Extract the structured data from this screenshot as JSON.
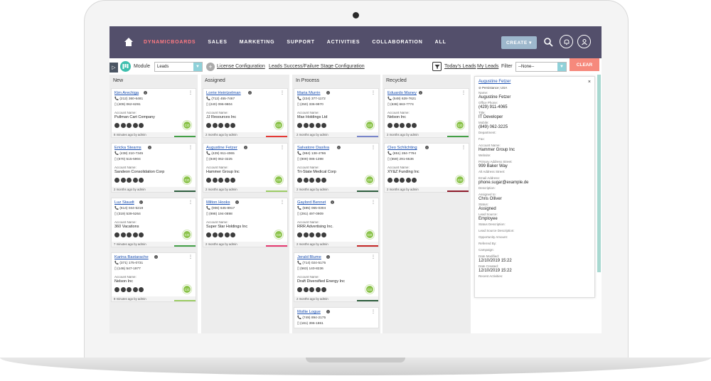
{
  "nav": {
    "items": [
      "DYNAMICBOARDS",
      "SALES",
      "MARKETING",
      "SUPPORT",
      "ACTIVITIES",
      "COLLABORATION",
      "ALL"
    ],
    "create_label": "CREATE ▾"
  },
  "toolbar": {
    "expander": "▷",
    "module_label": "Module",
    "module_value": "Leads",
    "license_link": "License Configuration",
    "stage_link": "Leads Success/Failure Stage Configuration",
    "todays_leads": "Today's Leads",
    "my_leads": "My Leads",
    "filter_label": "Filter",
    "filter_value": "--None--",
    "clear_label": "CLEAR"
  },
  "colors": {
    "nav_bg": "#534f6b",
    "active_nav": "#ff7a82",
    "clear": "#f6897c",
    "avatar": "#8bc34a"
  },
  "columns": [
    {
      "title": "New",
      "cards": [
        {
          "name": "Kim Arechiga",
          "phone1": "(212) 360-6481",
          "phone2": "(409) 062-6291",
          "account_label": "Account Name:",
          "account": "Pullman Cart Company",
          "avatar": "CO",
          "footer": "8 minutes ago by admin",
          "bar": "#43a047"
        },
        {
          "name": "Ericka Stearns",
          "phone1": "(438) 210-7345",
          "phone2": "(670) 515-5904",
          "account_label": "Account Name:",
          "account": "Sandeon Consolidation Corp",
          "avatar": "CO",
          "footer": "2 months ago by admin",
          "bar": "#2e5e3e"
        },
        {
          "name": "Luz Staudt",
          "phone1": "(614) 044-5218",
          "phone2": "(319) 539-5264",
          "account_label": "Account Name:",
          "account": "360 Vacations",
          "avatar": "CO",
          "footer": "7 minutes ago by admin",
          "bar": "#43a047"
        },
        {
          "name": "Karina Bastarache",
          "phone1": "(371) 175-0731",
          "phone2": "(146) 547-1977",
          "account_label": "Account Name:",
          "account": "Nelson Inc",
          "avatar": "CO",
          "footer": "8 minutes ago by admin",
          "bar": "#9ccc65"
        }
      ]
    },
    {
      "title": "Assigned",
      "cards": [
        {
          "name": "Lorrie Heintzelman",
          "phone1": "(712) 455-7467",
          "phone2": "(240) 096-9804",
          "account_label": "Account Name:",
          "account": "JJ Resources Inc",
          "avatar": "CO",
          "footer": "2 months ago by admin",
          "bar": "#e53935"
        },
        {
          "name": "Augustine Fetzer",
          "phone1": "(429) 911-4065",
          "phone2": "(849) 062-3225",
          "account_label": "Account Name:",
          "account": "Hammer Group Inc",
          "avatar": "CO",
          "footer": "2 months ago by admin",
          "bar": "#9ccc65"
        },
        {
          "name": "Milton Hooks",
          "phone1": "(006) 645-8917",
          "phone2": "(998) 194-0898",
          "account_label": "Account Name:",
          "account": "Super Star Holdings Inc",
          "avatar": "CO",
          "footer": "2 months ago by admin",
          "bar": "#e53970"
        }
      ]
    },
    {
      "title": "In Process",
      "cards": [
        {
          "name": "Maria Murrin",
          "phone1": "(224) 377-1172",
          "phone2": "(250) 336-9970",
          "account_label": "Account Name:",
          "account": "Max Holdings Ltd",
          "avatar": "CO",
          "footer": "2 months ago by admin",
          "bar": "#7986cb"
        },
        {
          "name": "Salvatore Dasilva",
          "phone1": "(984) 138-4786",
          "phone2": "(809) 086-1398",
          "account_label": "Account Name:",
          "account": "Tri-State Medical Corp",
          "avatar": "CO",
          "footer": "2 months ago by admin",
          "bar": "#2e5e3e"
        },
        {
          "name": "Gaylord Bennet",
          "phone1": "(595) 065-0304",
          "phone2": "(291) 497-0909",
          "account_label": "Account Name:",
          "account": "RRR Advertising Inc.",
          "avatar": "CO",
          "footer": "2 months ago by admin",
          "bar": "#c62828"
        },
        {
          "name": "Jerald Blume",
          "phone1": "(714) 024-5175",
          "phone2": "(563) 140-8236",
          "account_label": "Account Name:",
          "account": "Draft Diversified Energy Inc",
          "avatar": "CO",
          "footer": "2 months ago by admin",
          "bar": "#2e5e3e"
        },
        {
          "name": "Mollie Logue",
          "phone1": "(749) 894-2175",
          "phone2": "(181) 396-1861",
          "account_label": "",
          "account": "",
          "avatar": "",
          "footer": "",
          "bar": ""
        }
      ]
    },
    {
      "title": "Recycled",
      "cards": [
        {
          "name": "Eduardo Maney",
          "phone1": "(548) 628-7621",
          "phone2": "(638) 663-7774",
          "account_label": "Account Name:",
          "account": "Nelson Inc",
          "avatar": "CO",
          "footer": "2 months ago by admin",
          "bar": "#43a047"
        },
        {
          "name": "Cleo Schlichting",
          "phone1": "(851) 284-7794",
          "phone2": "(559) 291-6536",
          "account_label": "Account Name:",
          "account": "XY&Z Funding Inc",
          "avatar": "CO",
          "footer": "2 months ago by admin",
          "bar": "#8e1b2a"
        }
      ]
    }
  ],
  "detail": {
    "name": "Augustine Fetzer",
    "sub": "⊘ Persistance; USA",
    "close": "×",
    "fields": [
      {
        "label": "Name:",
        "value": "Augustine Fetzer"
      },
      {
        "label": "Office Phone:",
        "value": "(429) 911-4065"
      },
      {
        "label": "Title:",
        "value": "IT Developer"
      },
      {
        "label": "Mobile:",
        "value": "(849) 062-3225"
      },
      {
        "label": "Department:",
        "value": ""
      },
      {
        "label": "Fax:",
        "value": ""
      },
      {
        "label": "Account Name:",
        "value": "Hammer Group Inc"
      },
      {
        "label": "Website:",
        "value": ""
      },
      {
        "label": "Primary Address Street:",
        "value": "999 Baker Way"
      },
      {
        "label": "Alt Address Street:",
        "value": ""
      },
      {
        "label": "Email Address:",
        "value": "phone.sugar@example.de"
      },
      {
        "label": "Description:",
        "value": ""
      },
      {
        "label": "Assigned to:",
        "value": "Chris Olliver"
      },
      {
        "label": "Status:",
        "value": "Assigned"
      },
      {
        "label": "Lead Source:",
        "value": "Employee"
      },
      {
        "label": "Status Description:",
        "value": ""
      },
      {
        "label": "Lead Source Description:",
        "value": ""
      },
      {
        "label": "Opportunity Amount:",
        "value": ""
      },
      {
        "label": "Referred By:",
        "value": ""
      },
      {
        "label": "Campaign:",
        "value": ""
      },
      {
        "label": "Date Modified:",
        "value": "12/10/2019 15:22"
      },
      {
        "label": "Date Created:",
        "value": "12/10/2019 15:22"
      },
      {
        "label": "Recent Activities:",
        "value": ""
      }
    ]
  }
}
